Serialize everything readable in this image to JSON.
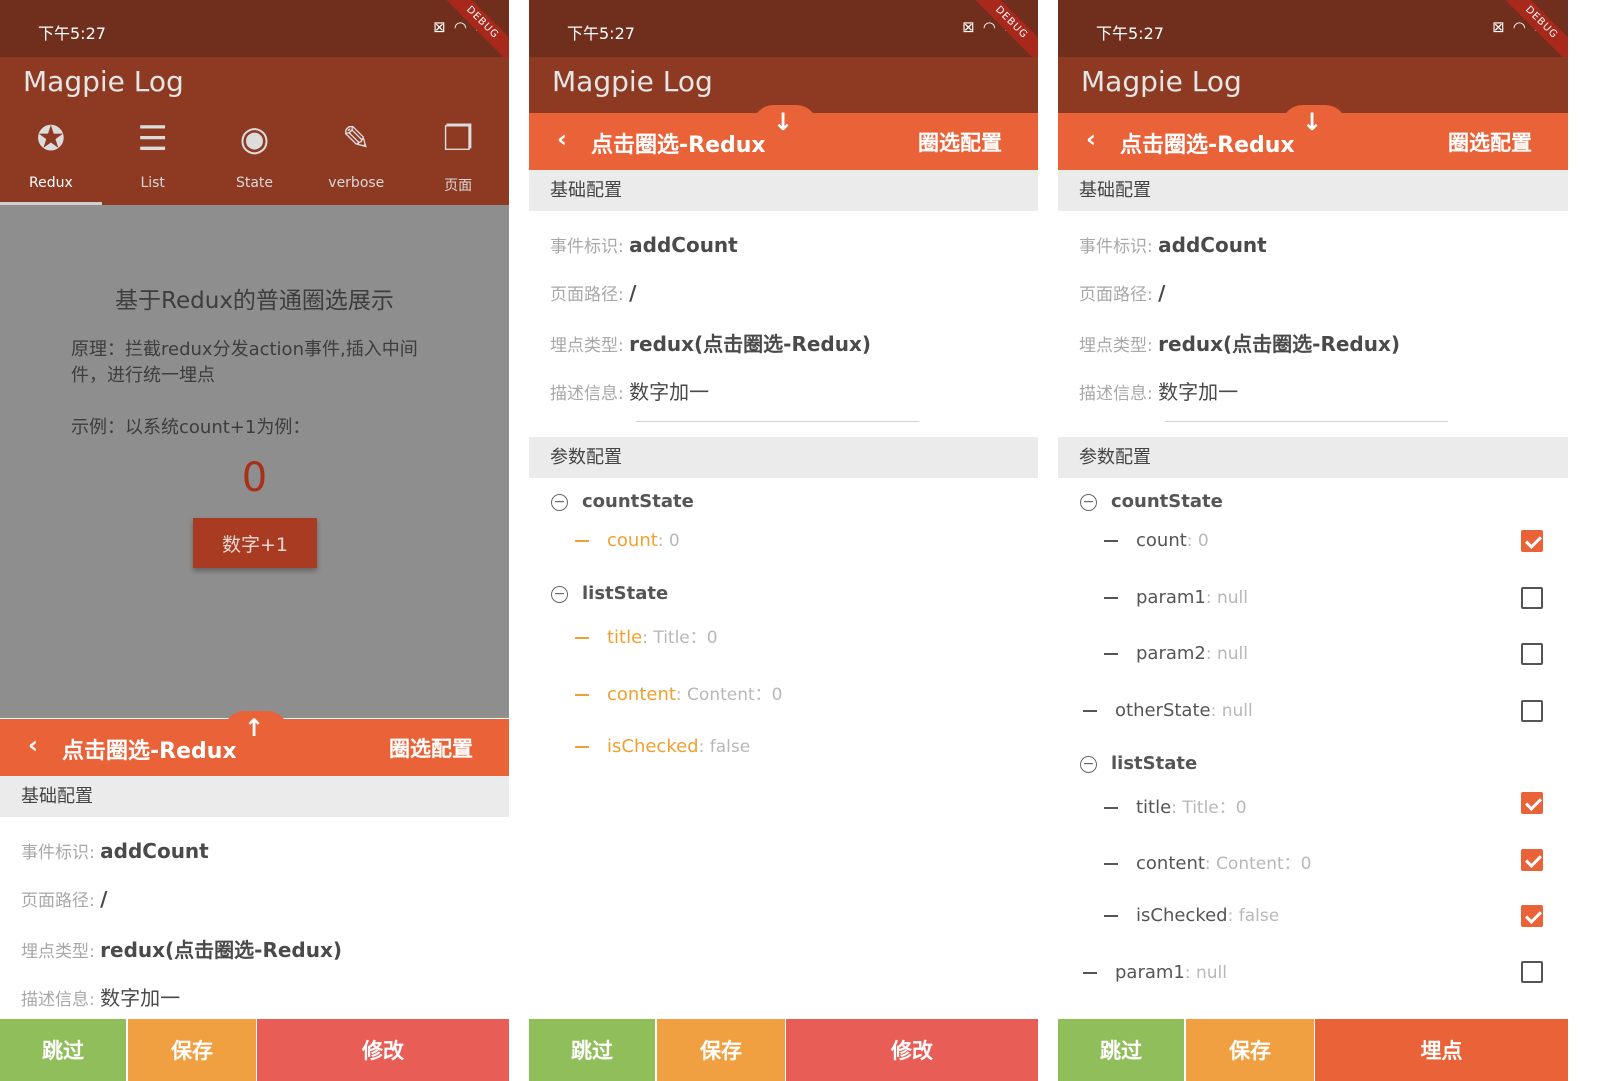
{
  "status": {
    "time": "下午5:27",
    "debug_label": "DEBUG"
  },
  "app": {
    "title": "Magpie Log"
  },
  "tabs": [
    {
      "label": "Redux",
      "icon": "redux-icon"
    },
    {
      "label": "List",
      "icon": "list-icon"
    },
    {
      "label": "State",
      "icon": "state-icon"
    },
    {
      "label": "verbose",
      "icon": "dropper-icon"
    },
    {
      "label": "页面",
      "icon": "copy-icon"
    }
  ],
  "demo": {
    "title": "基于Redux的普通圈选展示",
    "principle": "原理：拦截redux分发action事件,插入中间件，进行统一埋点",
    "example": "示例：以系统count+1为例：",
    "count": "0",
    "button_label": "数字+1"
  },
  "panel": {
    "back": "‹",
    "title": "点击圈选-Redux",
    "right": "圈选配置",
    "arrow_up": "↑",
    "arrow_down": "↓"
  },
  "basic_section": "基础配置",
  "param_section": "参数配置",
  "fields": {
    "event_id": {
      "label": "事件标识: ",
      "value": "addCount"
    },
    "page_path": {
      "label": "页面路径: ",
      "value": "/"
    },
    "point_type": {
      "label": "埋点类型: ",
      "value": "redux(点击圈选-Redux)"
    },
    "desc": {
      "label": "描述信息: ",
      "value": "数字加一"
    }
  },
  "tree2": {
    "countState": "countState",
    "count_key": "count",
    "count_val": ": 0",
    "listState": "listState",
    "title_key": "title",
    "title_val": ": Title：0",
    "content_key": "content",
    "content_val": ": Content：0",
    "checked_key": "isChecked",
    "checked_val": ": false"
  },
  "tree3": {
    "countState": "countState",
    "count_key": "count",
    "count_val": ": 0",
    "param1_key": "param1",
    "param1_val": ": null",
    "param2_key": "param2",
    "param2_val": ": null",
    "other_key": "otherState",
    "other_val": ": null",
    "listState": "listState",
    "title_key": "title",
    "title_val": ": Title：0",
    "content_key": "content",
    "content_val": ": Content：0",
    "checked_key": "isChecked",
    "checked_val": ": false",
    "param1b_key": "param1",
    "param1b_val": ": null",
    "checks": [
      true,
      false,
      false,
      false,
      true,
      true,
      true,
      false
    ]
  },
  "buttons": {
    "skip": "跳过",
    "save": "保存",
    "modify": "修改",
    "bury": "埋点"
  },
  "colors": {
    "primary": "#ea6238",
    "skip": "#90be5a",
    "save": "#f0a040",
    "modify": "#e85d55"
  }
}
